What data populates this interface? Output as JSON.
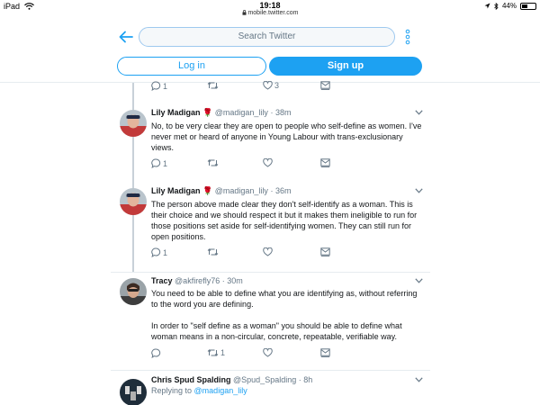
{
  "status_bar": {
    "device": "iPad",
    "time": "19:18",
    "url": "mobile.twitter.com",
    "battery": "44%",
    "battery_level": 0.44
  },
  "header": {
    "search_placeholder": "Search Twitter",
    "login_label": "Log in",
    "signup_label": "Sign up"
  },
  "top_actions": {
    "reply_count": "1",
    "retweet_count": "",
    "like_count": "3"
  },
  "tweets": [
    {
      "name": "Lily Madigan",
      "emoji": "🌹",
      "handle": "@madigan_lily",
      "time": "38m",
      "text": "No, to be very clear they are open to people who self-define as women. I've never met or heard of anyone in Young Labour with trans-exclusionary views.",
      "reply_count": "1",
      "retweet_count": "",
      "like_count": ""
    },
    {
      "name": "Lily Madigan",
      "emoji": "🌹",
      "handle": "@madigan_lily",
      "time": "36m",
      "text": "The person above made clear they don't self-identify as a woman. This is their choice and we should respect it but it makes them ineligible to run for those positions set aside for self-identifying women. They can still run for open positions.",
      "reply_count": "1",
      "retweet_count": "",
      "like_count": ""
    },
    {
      "name": "Tracy",
      "handle": "@akfirefly76",
      "time": "30m",
      "text_p1": "You need to be able to define what you are identifying as, without referring to the word you are defining.",
      "text_p2": "In order to \"self define as a woman\" you should be able to define what woman means in a non-circular, concrete, repeatable, verifiable way.",
      "reply_count": "",
      "retweet_count": "1",
      "like_count": ""
    },
    {
      "name": "Chris Spud Spalding",
      "handle": "@Spud_Spalding",
      "time": "8h",
      "replying_prefix": "Replying to",
      "replying_to": "@madigan_lily"
    }
  ],
  "colors": {
    "accent": "#1da1f2",
    "muted": "#657786",
    "text": "#14171a",
    "divider": "#e6ecf0"
  },
  "icons": [
    "wifi-icon",
    "lock-icon",
    "location-icon",
    "bluetooth-icon",
    "back-arrow-icon",
    "more-vertical-icon",
    "reply-icon",
    "retweet-icon",
    "like-icon",
    "dm-icon",
    "chevron-down-icon"
  ]
}
